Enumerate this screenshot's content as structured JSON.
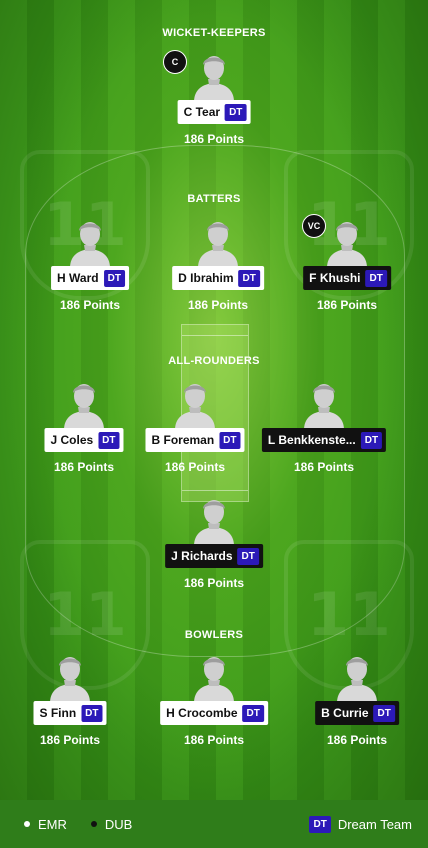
{
  "sections": {
    "wicket_keepers": "WICKET-KEEPERS",
    "batters": "BATTERS",
    "all_rounders": "ALL-ROUNDERS",
    "bowlers": "BOWLERS"
  },
  "badge_label": "DT",
  "watermark_text": "11",
  "roles": {
    "captain": "C",
    "vice_captain": "VC"
  },
  "players": [
    {
      "name": "C Tear",
      "points": "186 Points",
      "team": "EMR"
    },
    {
      "name": "H Ward",
      "points": "186 Points",
      "team": "EMR"
    },
    {
      "name": "D Ibrahim",
      "points": "186 Points",
      "team": "EMR"
    },
    {
      "name": "F Khushi",
      "points": "186 Points",
      "team": "DUB"
    },
    {
      "name": "J Coles",
      "points": "186 Points",
      "team": "EMR"
    },
    {
      "name": "B Foreman",
      "points": "186 Points",
      "team": "EMR"
    },
    {
      "name": "L Benkkenste...",
      "points": "186 Points",
      "team": "DUB"
    },
    {
      "name": "J Richards",
      "points": "186 Points",
      "team": "DUB"
    },
    {
      "name": "S Finn",
      "points": "186 Points",
      "team": "EMR"
    },
    {
      "name": "H Crocombe",
      "points": "186 Points",
      "team": "EMR"
    },
    {
      "name": "B Currie",
      "points": "186 Points",
      "team": "DUB"
    }
  ],
  "legend": {
    "team1": "EMR",
    "team2": "DUB",
    "dream_team_badge": "DT",
    "dream_team_label": "Dream Team"
  },
  "colors": {
    "dt_badge": "#2c19b8",
    "team1_label_bg": "#ffffff",
    "team2_label_bg": "#111111"
  },
  "icons": {
    "player": "person-silhouette-icon"
  }
}
